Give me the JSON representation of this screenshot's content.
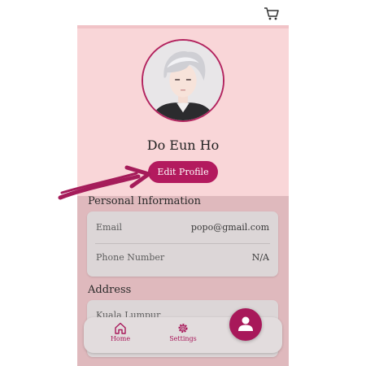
{
  "header": {
    "cart_icon": "shopping-cart-icon"
  },
  "profile": {
    "name": "Do Eun Ho",
    "edit_button_label": "Edit Profile"
  },
  "personal_information": {
    "title": "Personal Information",
    "fields": [
      {
        "label": "Email",
        "value": "popo@gmail.com"
      },
      {
        "label": "Phone Number",
        "value": "N/A"
      }
    ]
  },
  "address": {
    "title": "Address",
    "lines": [
      "Kuala Lumpur"
    ]
  },
  "bottom_nav": {
    "items": [
      {
        "label": "Home",
        "icon": "home-icon"
      },
      {
        "label": "Settings",
        "icon": "gear-icon"
      }
    ],
    "fab_icon": "person-icon"
  },
  "colors": {
    "accent": "#b31a5e",
    "top_background": "#f9d6d8",
    "bottom_background": "#dfb9bd",
    "card": "#dcd6d7"
  }
}
